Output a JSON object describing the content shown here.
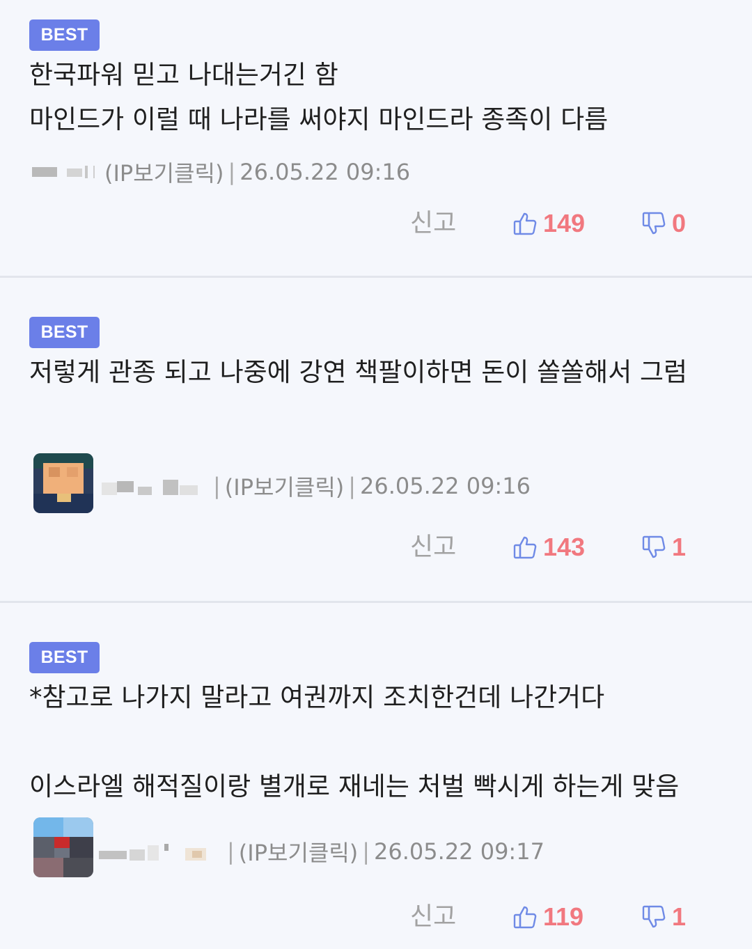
{
  "comments": [
    {
      "badge": "BEST",
      "text": "한국파워 믿고 나대는거긴 함\n마인드가 이럴 때 나라를 써야지 마인드라 종족이 다름",
      "ip_label": "(IP보기클릭)",
      "date": "26.05.22 09:16",
      "report_label": "신고",
      "likes": "149",
      "dislikes": "0"
    },
    {
      "badge": "BEST",
      "text": "저렇게 관종 되고 나중에 강연 책팔이하면 돈이 쏠쏠해서 그럼",
      "ip_label": "(IP보기클릭)",
      "date": "26.05.22 09:16",
      "report_label": "신고",
      "likes": "143",
      "dislikes": "1"
    },
    {
      "badge": "BEST",
      "text": "*참고로 나가지 말라고 여권까지 조치한건데 나간거다\n\n이스라엘 해적질이랑 별개로 재네는 처벌 빡시게 하는게 맞음",
      "ip_label": "(IP보기클릭)",
      "date": "26.05.22 09:17",
      "report_label": "신고",
      "likes": "119",
      "dislikes": "1"
    }
  ],
  "colors": {
    "badge": "#6b7fe8",
    "count": "#f1787f",
    "thumb_icon": "#6f8ae6",
    "meta": "#8c8c8c"
  },
  "icons": {
    "like": "thumbs-up-icon",
    "dislike": "thumbs-down-icon",
    "avatar": "avatar"
  }
}
